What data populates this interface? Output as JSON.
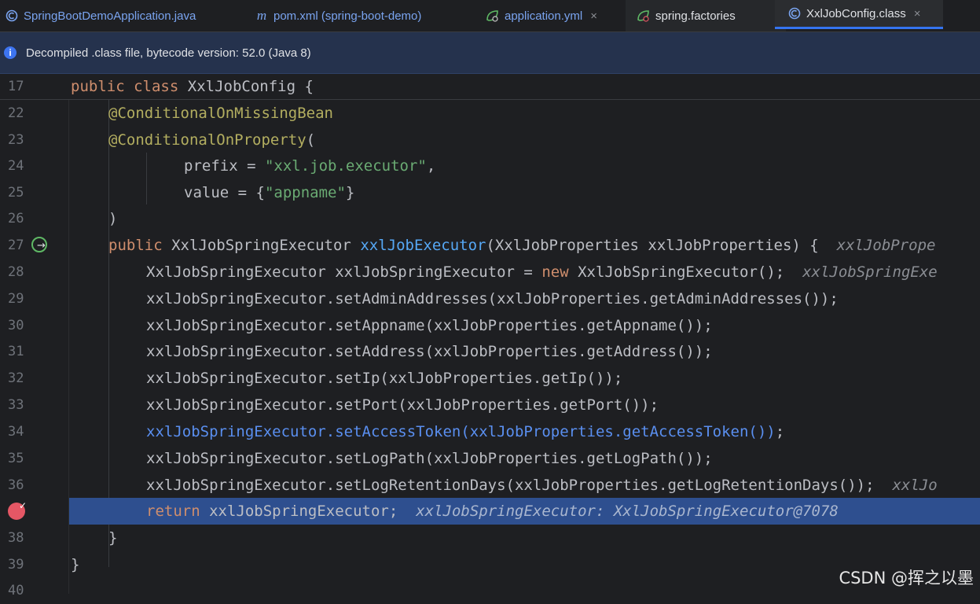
{
  "tabs": [
    {
      "label": "SpringBootDemoApplication.java",
      "icon": "java-class-icon"
    },
    {
      "label": "pom.xml (spring-boot-demo)",
      "icon": "maven-icon"
    },
    {
      "label": "application.yml",
      "icon": "spring-config-icon"
    },
    {
      "label": "spring.factories",
      "icon": "spring-config-icon"
    },
    {
      "label": "XxlJobConfig.class",
      "icon": "class-icon"
    }
  ],
  "close_glyph": "×",
  "banner": {
    "text": "Decompiled .class file, bytecode version: 52.0 (Java 8)",
    "icon": "info-icon"
  },
  "sticky": {
    "line": "17",
    "kw1": "public",
    "kw2": "class",
    "rest": "XxlJobConfig {"
  },
  "lines": {
    "l22": {
      "num": "22",
      "ann": "@ConditionalOnMissingBean"
    },
    "l23": {
      "num": "23",
      "ann": "@ConditionalOnProperty",
      "rest": "("
    },
    "l24": {
      "num": "24",
      "a": "prefix = ",
      "str": "\"xxl.job.executor\"",
      "b": ","
    },
    "l25": {
      "num": "25",
      "a": "value = {",
      "str": "\"appname\"",
      "b": "}"
    },
    "l26": {
      "num": "26",
      "text": ")"
    },
    "l27": {
      "num": "27",
      "kw": "public",
      "type": "XxlJobSpringExecutor",
      "fn": "xxlJobExecutor",
      "params": "(XxlJobProperties xxlJobProperties) {",
      "inlay": "xxlJobPrope"
    },
    "l28": {
      "num": "28",
      "a": "XxlJobSpringExecutor xxlJobSpringExecutor = ",
      "kw": "new",
      "b": "XxlJobSpringExecutor();",
      "inlay": "xxlJobSpringExe"
    },
    "l29": {
      "num": "29",
      "text": "xxlJobSpringExecutor.setAdminAddresses(xxlJobProperties.getAdminAddresses());"
    },
    "l30": {
      "num": "30",
      "text": "xxlJobSpringExecutor.setAppname(xxlJobProperties.getAppname());"
    },
    "l31": {
      "num": "31",
      "text": "xxlJobSpringExecutor.setAddress(xxlJobProperties.getAddress());"
    },
    "l32": {
      "num": "32",
      "text": "xxlJobSpringExecutor.setIp(xxlJobProperties.getIp());"
    },
    "l33": {
      "num": "33",
      "text": "xxlJobSpringExecutor.setPort(xxlJobProperties.getPort());"
    },
    "l34": {
      "num": "34",
      "text": "xxlJobSpringExecutor.setAccessToken(xxlJobProperties.getAccessToken())",
      "tail": ";"
    },
    "l35": {
      "num": "35",
      "text": "xxlJobSpringExecutor.setLogPath(xxlJobProperties.getLogPath());"
    },
    "l36": {
      "num": "36",
      "text": "xxlJobSpringExecutor.setLogRetentionDays(xxlJobProperties.getLogRetentionDays());",
      "inlay": "xxlJo"
    },
    "l37": {
      "kw": "return",
      "rest": "xxlJobSpringExecutor;",
      "inlay": "xxlJobSpringExecutor: XxlJobSpringExecutor@7078"
    },
    "l38": {
      "num": "38",
      "text": "}"
    },
    "l39": {
      "num": "39",
      "text": "}"
    },
    "l40": {
      "num": "40"
    }
  },
  "watermark": "CSDN @挥之以墨"
}
